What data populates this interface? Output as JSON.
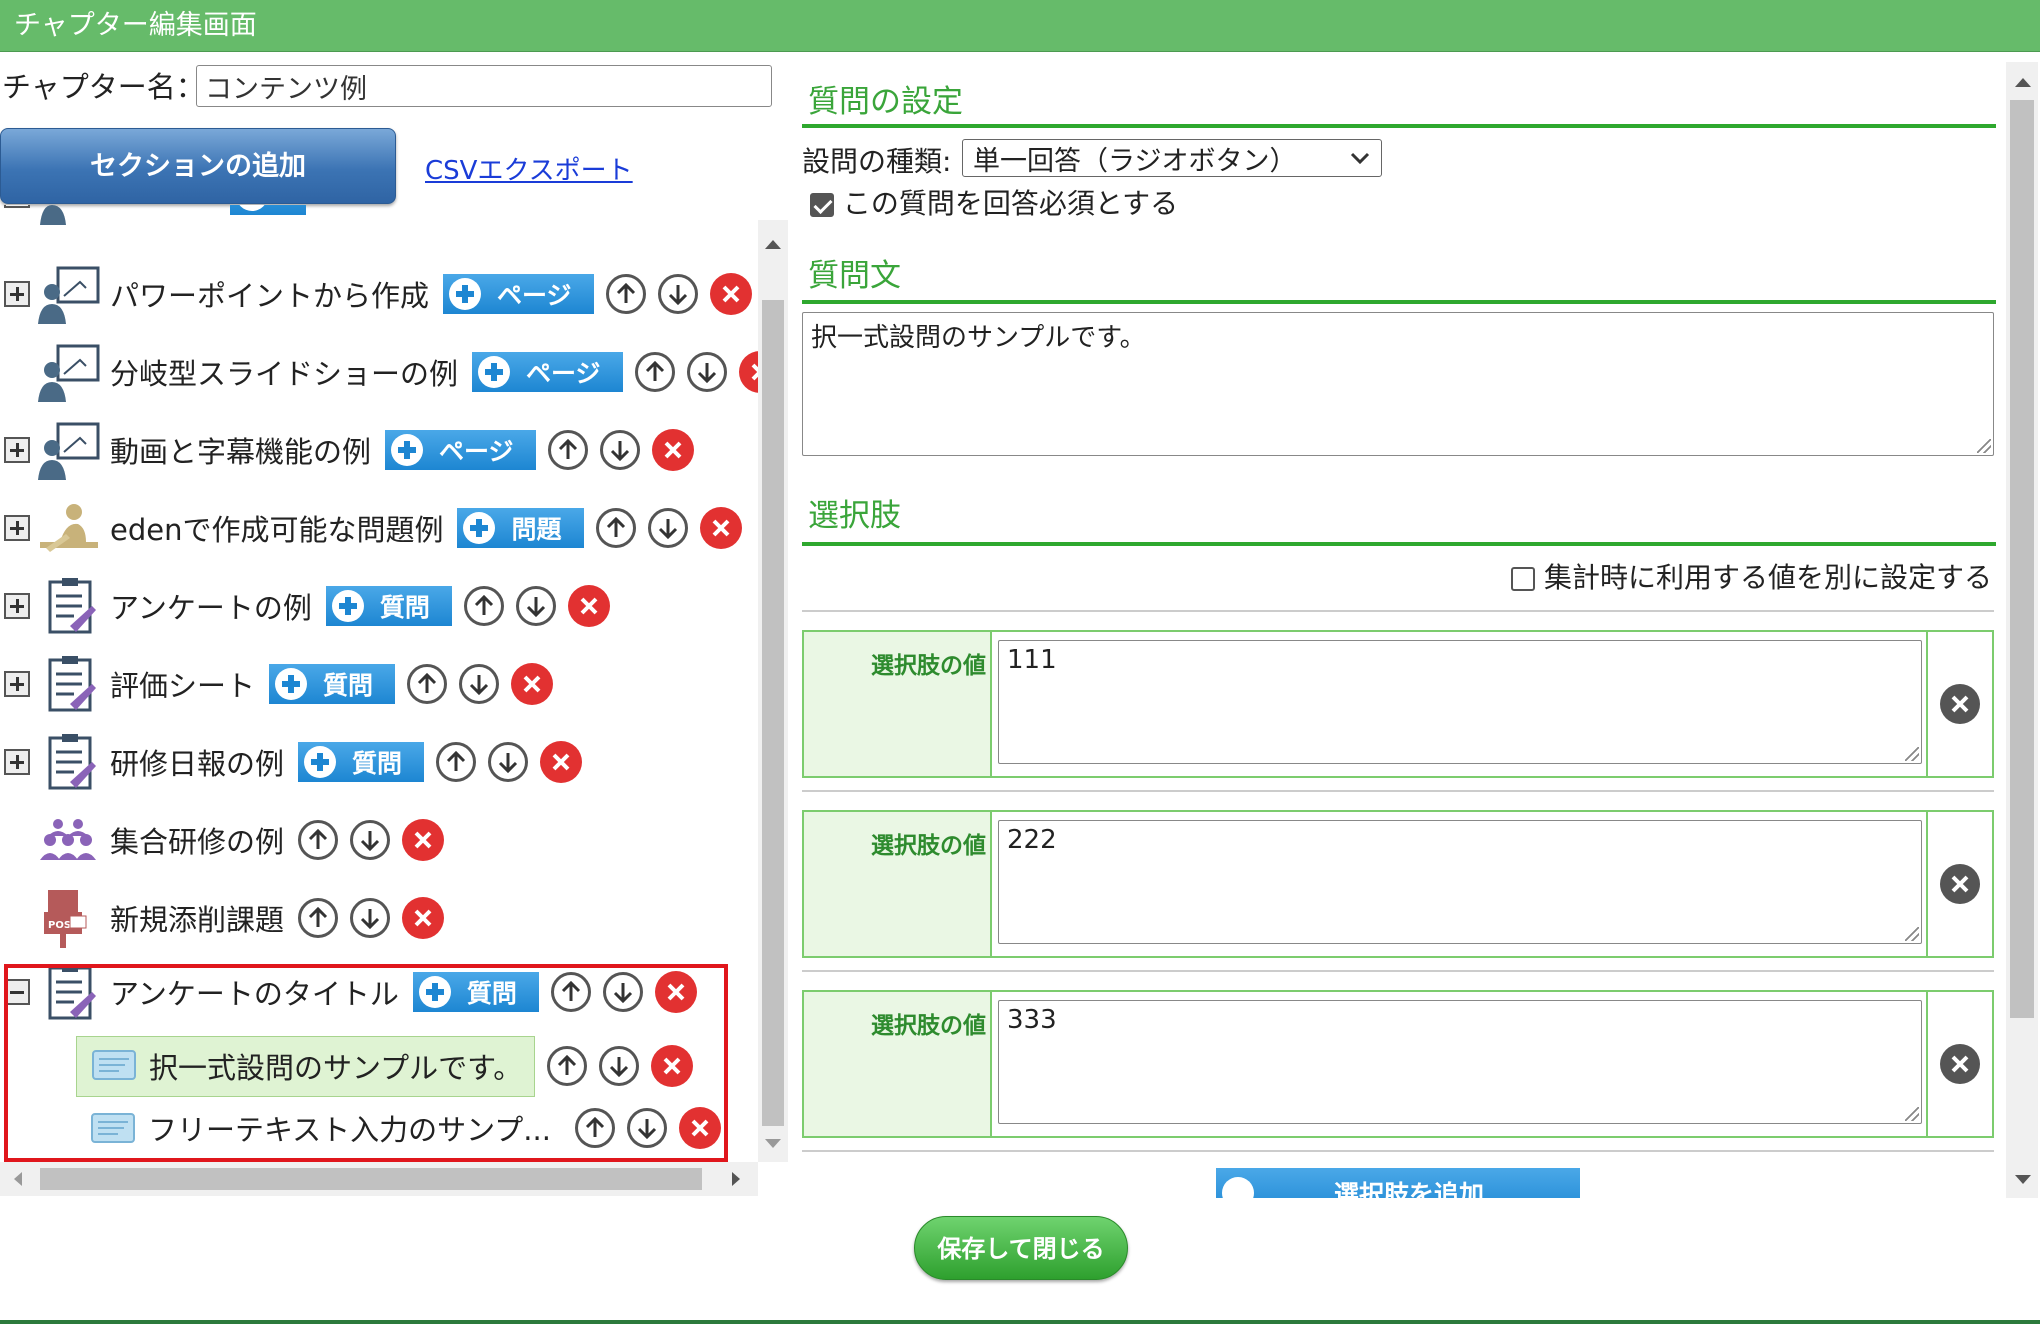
{
  "window": {
    "title": "チャプター編集画面"
  },
  "chapter": {
    "name_label": "チャプター名：",
    "name_value": "コンテンツ例"
  },
  "toolbar": {
    "add_section_label": "セクションの追加",
    "csv_export_label": "CSVエクスポート"
  },
  "tree": {
    "items": [
      {
        "label": "パワーポイントから作成",
        "icon": "presenter-icon",
        "add_label": "ページ",
        "expandable": true
      },
      {
        "label": "分岐型スライドショーの例",
        "icon": "presenter-icon",
        "add_label": "ページ",
        "expandable": false
      },
      {
        "label": "動画と字幕機能の例",
        "icon": "presenter-icon",
        "add_label": "ページ",
        "expandable": true
      },
      {
        "label": "edenで作成可能な問題例",
        "icon": "study-icon",
        "add_label": "問題",
        "expandable": true
      },
      {
        "label": "アンケートの例",
        "icon": "clipboard-icon",
        "add_label": "質問",
        "expandable": true
      },
      {
        "label": "評価シート",
        "icon": "clipboard-icon",
        "add_label": "質問",
        "expandable": true
      },
      {
        "label": "研修日報の例",
        "icon": "clipboard-icon",
        "add_label": "質問",
        "expandable": true
      },
      {
        "label": "集合研修の例",
        "icon": "group-icon",
        "add_label": "",
        "expandable": false
      },
      {
        "label": "新規添削課題",
        "icon": "post-icon",
        "add_label": "",
        "expandable": false
      }
    ],
    "selected_section": {
      "label": "アンケートのタイトル",
      "add_label": "質問",
      "children": [
        {
          "label": "択一式設問のサンプルです。",
          "selected": true
        },
        {
          "label": "フリーテキスト入力のサンプ..."
        }
      ]
    }
  },
  "question_settings": {
    "heading": "質問の設定",
    "type_label": "設問の種類:",
    "type_value": "単一回答（ラジオボタン）",
    "required_label": "この質問を回答必須とする",
    "required_checked": true
  },
  "question_text": {
    "heading": "質問文",
    "value": "択一式設問のサンプルです。"
  },
  "options": {
    "heading": "選択肢",
    "separate_value_label": "集計時に利用する値を別に設定する",
    "separate_value_checked": false,
    "value_label": "選択肢の値",
    "items": [
      {
        "value": "111"
      },
      {
        "value": "222"
      },
      {
        "value": "333"
      }
    ],
    "add_label": "選択肢を追加"
  },
  "footer": {
    "save_close_label": "保存して閉じる"
  },
  "colors": {
    "title_bar": "#66bb6a",
    "accent_green": "#2ea82e",
    "button_blue": "#1d86d2",
    "delete_red": "#e23131",
    "highlight_red": "#e0161c"
  }
}
